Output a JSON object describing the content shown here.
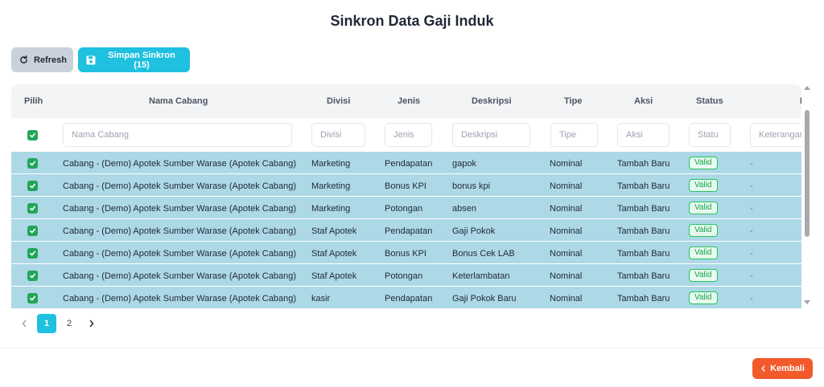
{
  "page": {
    "title": "Sinkron Data Gaji Induk"
  },
  "toolbar": {
    "refresh_label": "Refresh",
    "save_label": "Simpan Sinkron (15)"
  },
  "table": {
    "headers": {
      "pilih": "Pilih",
      "nama_cabang": "Nama Cabang",
      "divisi": "Divisi",
      "jenis": "Jenis",
      "deskripsi": "Deskripsi",
      "tipe": "Tipe",
      "aksi": "Aksi",
      "status": "Status",
      "keterangan": "K"
    },
    "filters": {
      "nama_cabang": "Nama Cabang",
      "divisi": "Divisi",
      "jenis": "Jenis",
      "deskripsi": "Deskripsi",
      "tipe": "Tipe",
      "aksi": "Aksi",
      "status": "Statu",
      "keterangan": "Keterangan"
    },
    "rows": [
      {
        "cabang": "Cabang - (Demo) Apotek Sumber Warase (Apotek Cabang)",
        "divisi": "Marketing",
        "jenis": "Pendapatan",
        "deskripsi": "gapok",
        "tipe": "Nominal",
        "aksi": "Tambah Baru",
        "status": "Valid",
        "keterangan": "-"
      },
      {
        "cabang": "Cabang - (Demo) Apotek Sumber Warase (Apotek Cabang)",
        "divisi": "Marketing",
        "jenis": "Bonus KPI",
        "deskripsi": "bonus kpi",
        "tipe": "Nominal",
        "aksi": "Tambah Baru",
        "status": "Valid",
        "keterangan": "-"
      },
      {
        "cabang": "Cabang - (Demo) Apotek Sumber Warase (Apotek Cabang)",
        "divisi": "Marketing",
        "jenis": "Potongan",
        "deskripsi": "absen",
        "tipe": "Nominal",
        "aksi": "Tambah Baru",
        "status": "Valid",
        "keterangan": "-"
      },
      {
        "cabang": "Cabang - (Demo) Apotek Sumber Warase (Apotek Cabang)",
        "divisi": "Staf Apotek",
        "jenis": "Pendapatan",
        "deskripsi": "Gaji Pokok",
        "tipe": "Nominal",
        "aksi": "Tambah Baru",
        "status": "Valid",
        "keterangan": "-"
      },
      {
        "cabang": "Cabang - (Demo) Apotek Sumber Warase (Apotek Cabang)",
        "divisi": "Staf Apotek",
        "jenis": "Bonus KPI",
        "deskripsi": "Bonus Cek LAB",
        "tipe": "Nominal",
        "aksi": "Tambah Baru",
        "status": "Valid",
        "keterangan": "-"
      },
      {
        "cabang": "Cabang - (Demo) Apotek Sumber Warase (Apotek Cabang)",
        "divisi": "Staf Apotek",
        "jenis": "Potongan",
        "deskripsi": "Keterlambatan",
        "tipe": "Nominal",
        "aksi": "Tambah Baru",
        "status": "Valid",
        "keterangan": "-"
      },
      {
        "cabang": "Cabang - (Demo) Apotek Sumber Warase (Apotek Cabang)",
        "divisi": "kasir",
        "jenis": "Pendapatan",
        "deskripsi": "Gaji Pokok Baru",
        "tipe": "Nominal",
        "aksi": "Tambah Baru",
        "status": "Valid",
        "keterangan": "-"
      }
    ]
  },
  "pagination": {
    "pages": [
      "1",
      "2"
    ],
    "current": "1"
  },
  "footer": {
    "back_label": "Kembali"
  },
  "colors": {
    "accent": "#1fc0e0",
    "row_selected": "#add8e6",
    "valid": "#22c55e",
    "back": "#f25a2c",
    "checkbox": "#22a55a"
  }
}
